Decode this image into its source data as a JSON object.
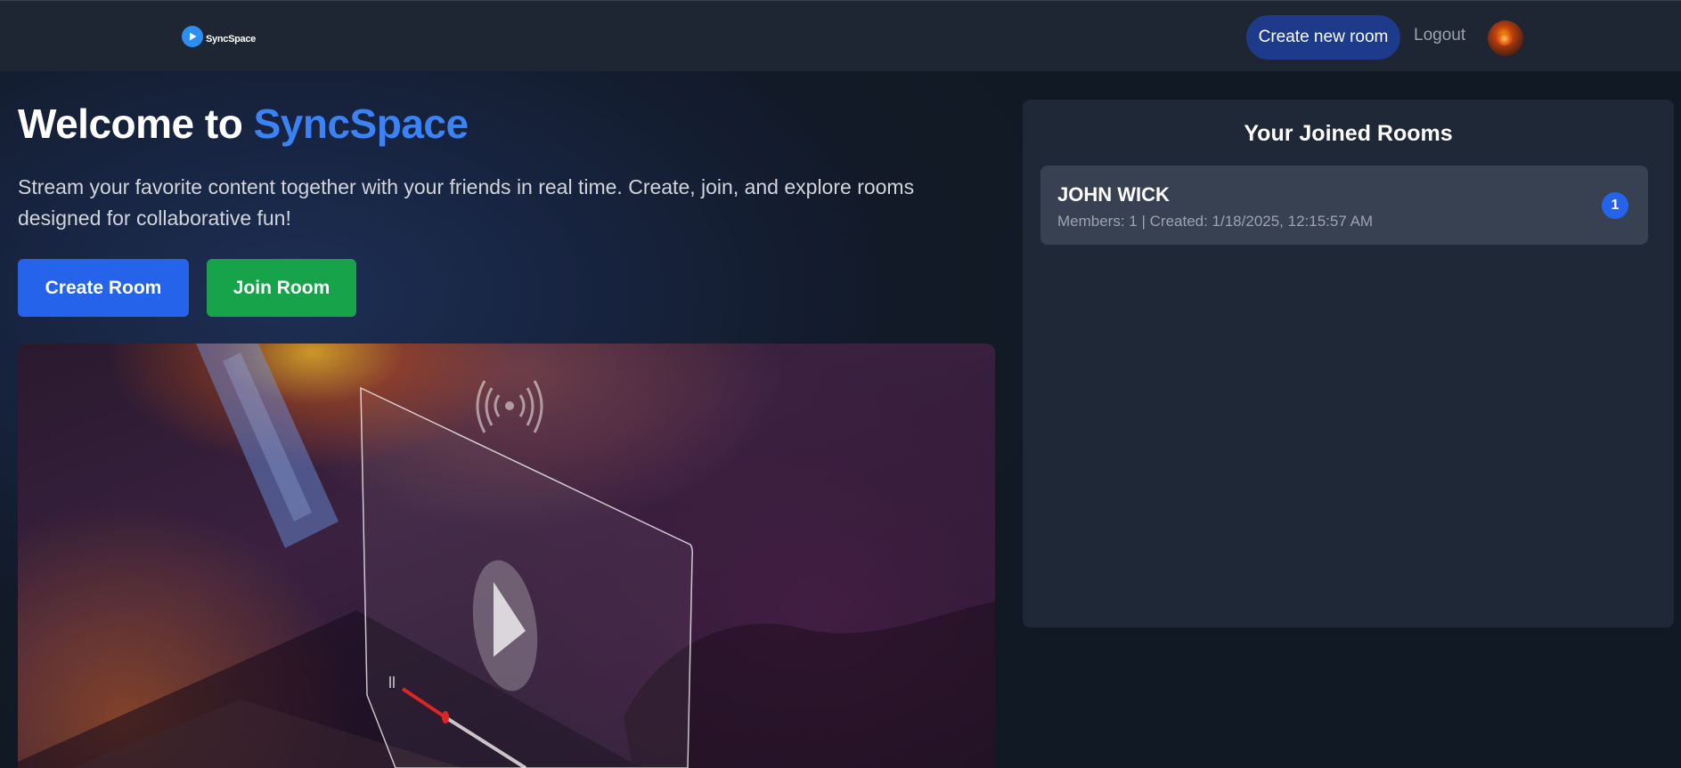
{
  "header": {
    "logo_text": "SyncSpace",
    "create_room_label": "Create new room",
    "logout_label": "Logout"
  },
  "hero": {
    "title_prefix": "Welcome to ",
    "title_brand": "SyncSpace",
    "description": "Stream your favorite content together with your friends in real time. Create, join, and explore rooms designed for collaborative fun!",
    "create_button": "Create Room",
    "join_button": "Join Room",
    "image_icons": [
      "play-icon",
      "broadcast-icon",
      "pause-icon"
    ]
  },
  "joined_rooms": {
    "title": "Your Joined Rooms",
    "rooms": [
      {
        "name": "JOHN WICK",
        "members_text": "Members: 1",
        "separator": " | ",
        "created_text": "Created: 1/18/2025, 12:15:57 AM",
        "badge": "1"
      }
    ]
  },
  "colors": {
    "brand_blue": "#3b82f6",
    "create_button": "#2563eb",
    "join_button": "#16a34a",
    "nav_create_button": "#1e3a8a"
  }
}
